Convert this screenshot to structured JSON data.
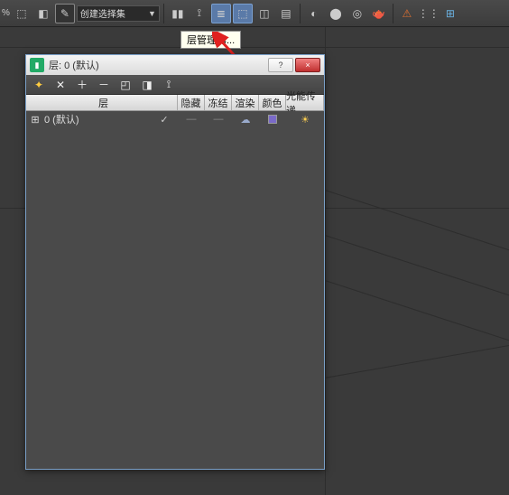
{
  "toolbar": {
    "pct_label": "%",
    "btn1_label": "⬚",
    "btn2_label": "◧",
    "pencil_label": "✎",
    "combo_value": "创建选择集",
    "mirror_label": "▮▮",
    "align_label": "⟟",
    "layer_label": "≣",
    "layer2_label": "⬚",
    "curve_label": "◫",
    "graph_label": "▤",
    "mat1_label": "◐",
    "mat2_label": "⬤",
    "mat3_label": "◎",
    "teapot_label": "🫖",
    "warn_label": "⚠",
    "dots_label": "⋮⋮",
    "grid_label": "⊞",
    "tooltip_text": "层管理器..."
  },
  "dialog": {
    "title": "层: 0 (默认)",
    "help_label": "?",
    "close_label": "×",
    "tool_new": "✦",
    "tool_del": "✕",
    "tool_add": "＋",
    "tool_rem": "－",
    "tool_sel": "◰",
    "tool_hl": "◨",
    "tool_hide": "⟟",
    "columns": {
      "name": "层",
      "hide": "隐藏",
      "freeze": "冻结",
      "render": "渲染",
      "color": "颜色",
      "radiosity": "光能传递"
    },
    "row0": {
      "name": "0 (默认)",
      "check": "✓",
      "dash1": "—",
      "dash2": "—",
      "render_icon": "☁",
      "bulb": "☀"
    }
  }
}
